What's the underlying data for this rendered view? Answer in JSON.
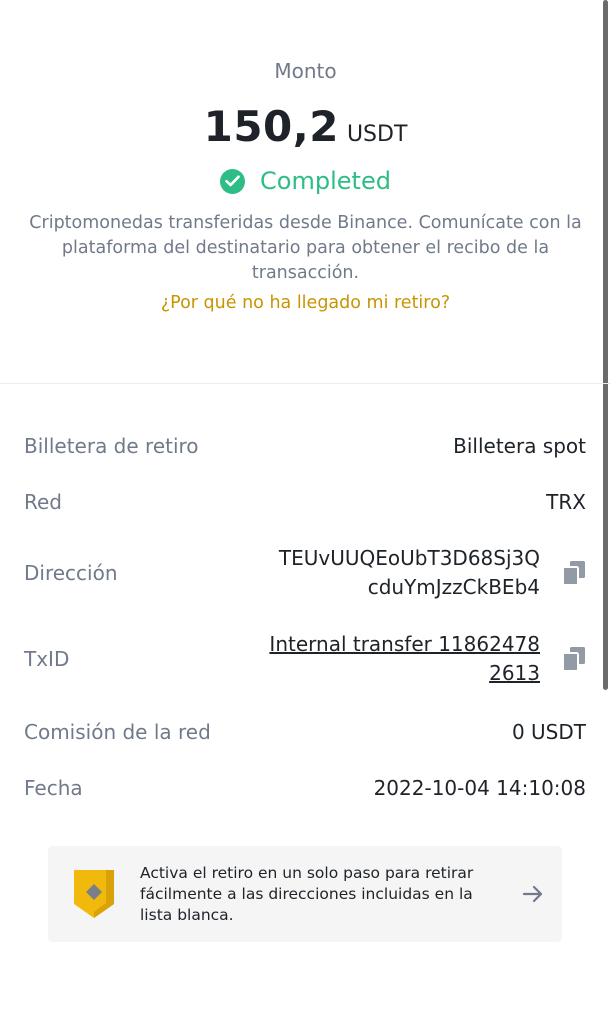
{
  "summary": {
    "amount_label": "Monto",
    "amount_value": "150,2",
    "amount_unit": "USDT",
    "status": "Completed",
    "description": "Criptomonedas transferidas desde Binance. Comunícate con la plataforma del destinatario para obtener el recibo de la transacción.",
    "help_link": "¿Por qué no ha llegado mi retiro?"
  },
  "details": {
    "wallet_label": "Billetera de retiro",
    "wallet_value": "Billetera spot",
    "network_label": "Red",
    "network_value": "TRX",
    "address_label": "Dirección",
    "address_line1": "TEUvUUQEoUbT3D68Sj3Q",
    "address_line2": "cduYmJzzCkBEb4",
    "txid_label": "TxID",
    "txid_line1": "Internal transfer 11862478",
    "txid_line2": "2613",
    "fee_label": "Comisión de la red",
    "fee_value": "0 USDT",
    "date_label": "Fecha",
    "date_value": "2022-10-04 14:10:08"
  },
  "banner": {
    "text": "Activa el retiro en un solo paso para retirar fácilmente a las direcciones incluidas en la lista blanca."
  },
  "colors": {
    "success": "#2ebd85",
    "link": "#c99400",
    "label": "#707a8a",
    "text": "#1e2329",
    "shield": "#f0b90b"
  },
  "icons": {
    "status": "check-circle-icon",
    "copy": "copy-icon",
    "banner": "shield-icon",
    "arrow": "arrow-right-icon"
  }
}
